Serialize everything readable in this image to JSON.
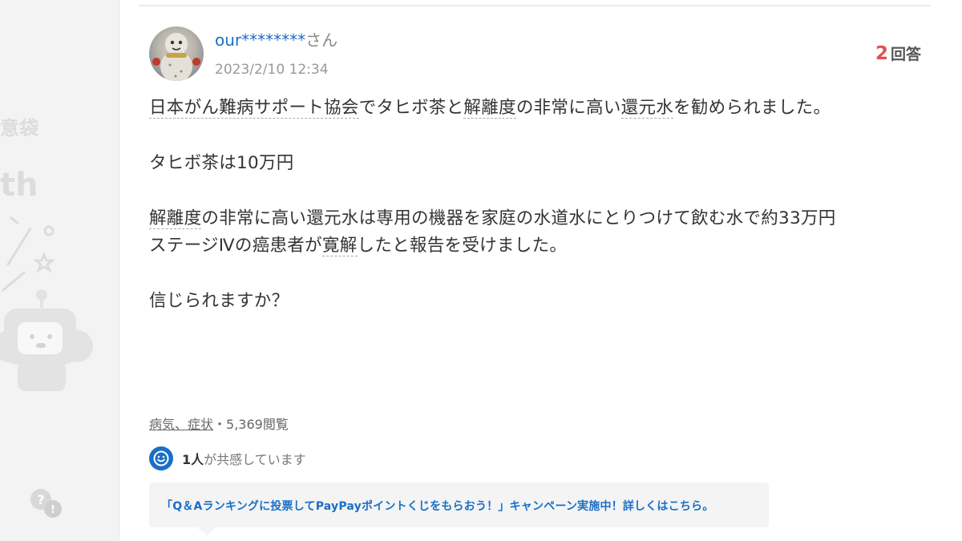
{
  "sidebar_decor": {
    "text_1": "意袋",
    "text_2": "th",
    "help_icon": "question-exclamation-icon"
  },
  "question": {
    "username": "our********",
    "username_suffix": "さん",
    "date": "2023/2/10 12:34",
    "answer_count": "2",
    "answer_label": "回答",
    "body": {
      "line1_a": "日本がん難病サポート協会",
      "line1_b": "でタヒボ茶と",
      "line1_c": "解離度",
      "line1_d": "の非常に高い",
      "line1_e": "還元水",
      "line1_f": "を勧められました。",
      "para2": "タヒボ茶は10万円",
      "para3_a": "解離度",
      "para3_b": "の非常に高い還元水は専用の機器を家庭の水道水にとりつけて飲む水で約33万円",
      "para4_a": "ステージⅣの癌患者が",
      "para4_b": "寛解",
      "para4_c": "したと報告を受けました。",
      "para5": "信じられますか？"
    },
    "category": "病気、症状",
    "separator": "・",
    "views": "5,369閲覧",
    "empathy_count": "1人",
    "empathy_text": "が共感しています",
    "campaign_text": "「Q＆Aランキングに投票してPayPayポイントくじをもらおう！」キャンペーン実施中！詳しくはこちら。"
  },
  "colors": {
    "link_blue": "#1a6fc7",
    "answer_count_red": "#e0524f",
    "background": "#f3f3f3"
  }
}
